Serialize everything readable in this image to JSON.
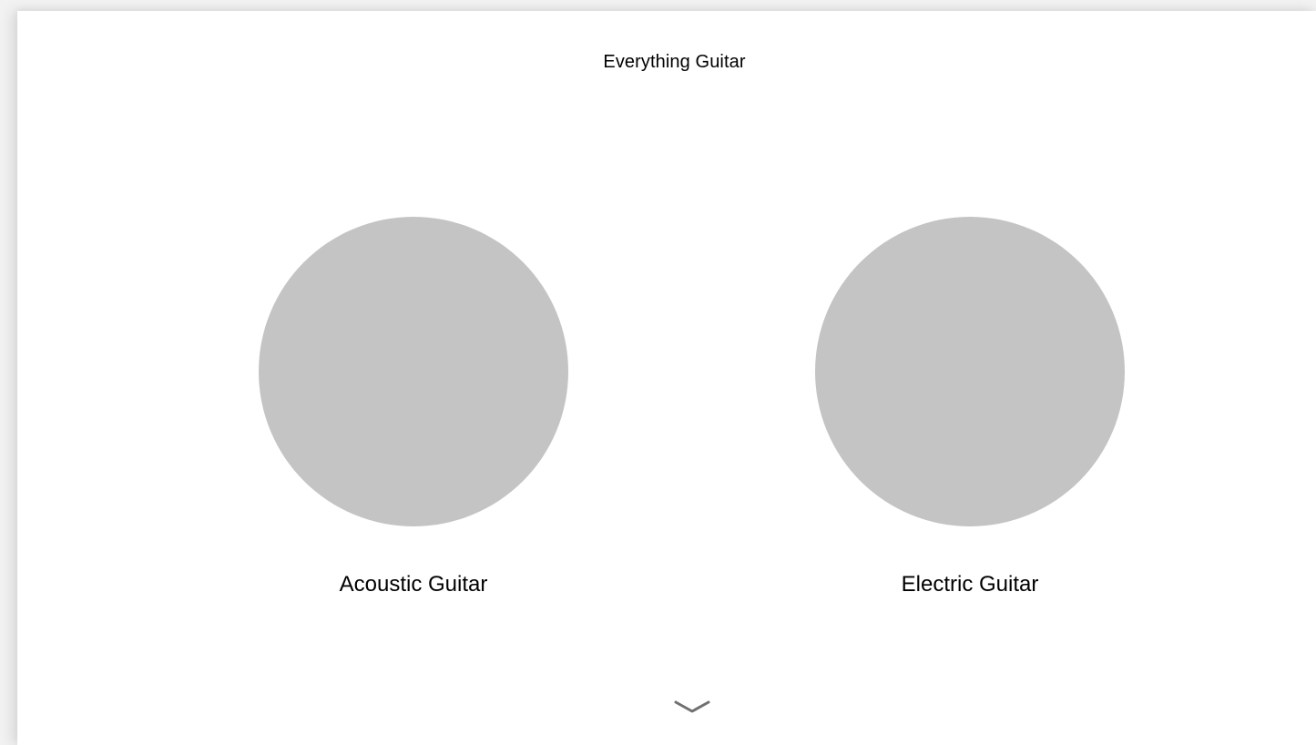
{
  "header": {
    "title": "Everything Guitar"
  },
  "categories": [
    {
      "label": "Acoustic Guitar",
      "image_color": "#c4c4c4"
    },
    {
      "label": "Electric Guitar",
      "image_color": "#c4c4c4"
    }
  ],
  "scroll_indicator": {
    "icon": "chevron-down-icon",
    "color": "#707070"
  }
}
